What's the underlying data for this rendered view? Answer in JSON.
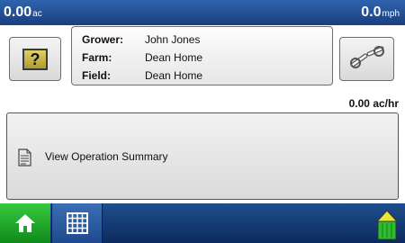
{
  "status_bar": {
    "area_value": "0.00",
    "area_unit": "ac",
    "speed_value": "0.0",
    "speed_unit": "mph"
  },
  "info": {
    "grower_label": "Grower:",
    "grower_value": "John Jones",
    "farm_label": "Farm:",
    "farm_value": "Dean Home",
    "field_label": "Field:",
    "field_value": "Dean Home"
  },
  "rate": {
    "text": "0.00 ac/hr"
  },
  "operation": {
    "label": "View Operation Summary"
  },
  "icons": {
    "help": "help-question-icon",
    "settings": "wrench-icon",
    "document": "document-icon",
    "home": "home-icon",
    "grid": "grid-icon",
    "tank": "tank-level-icon"
  },
  "colors": {
    "bar_blue": "#2f63ad",
    "home_green": "#1fa82a",
    "tank_green": "#2ebd2e",
    "tank_yellow": "#e9e33a"
  }
}
